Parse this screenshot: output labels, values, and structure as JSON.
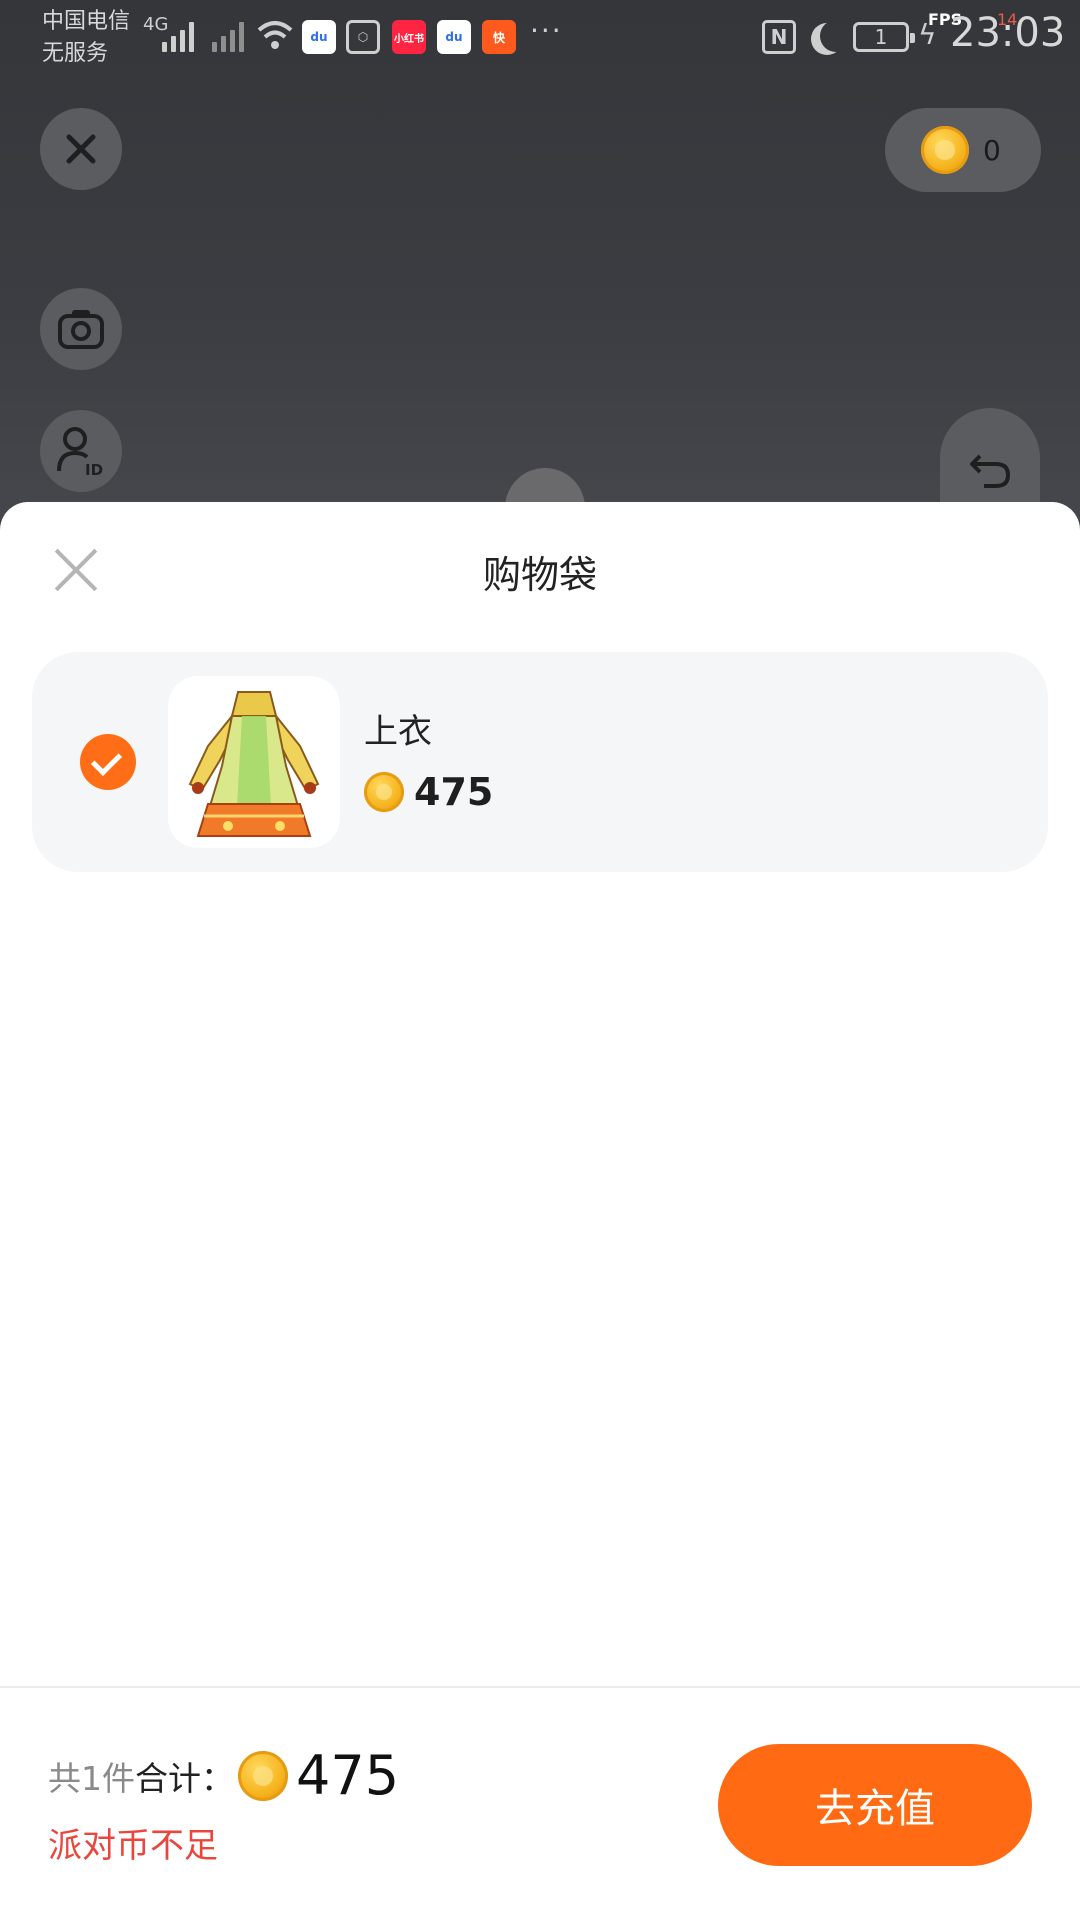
{
  "status_bar": {
    "carrier": "中国电信",
    "service": "无服务",
    "network": "4G",
    "battery": "1",
    "fps_label": "FPS",
    "fps_value": "14",
    "time": "23:03"
  },
  "status_apps": [
    {
      "name": "baidu",
      "label": "du",
      "color": "#2f6fe8"
    },
    {
      "name": "hexagon",
      "label": "⬡",
      "color": "#3a3c40"
    },
    {
      "name": "xiaohongshu",
      "label": "小红书",
      "color": "#ff2442"
    },
    {
      "name": "baidu-2",
      "label": "du",
      "color": "#2f6fe8"
    },
    {
      "name": "kuaishou",
      "label": "快",
      "color": "#ff5a1e"
    }
  ],
  "top_controls": {
    "coin_balance": "0"
  },
  "sheet": {
    "title": "购物袋",
    "items": [
      {
        "name": "上衣",
        "price": "475",
        "selected": true
      }
    ]
  },
  "footer": {
    "count_text": "共1件",
    "total_label": "合计：",
    "total": "475",
    "warning": "派对币不足",
    "button": "去充值"
  },
  "colors": {
    "accent": "#ff6a12",
    "warning": "#e8473c"
  }
}
